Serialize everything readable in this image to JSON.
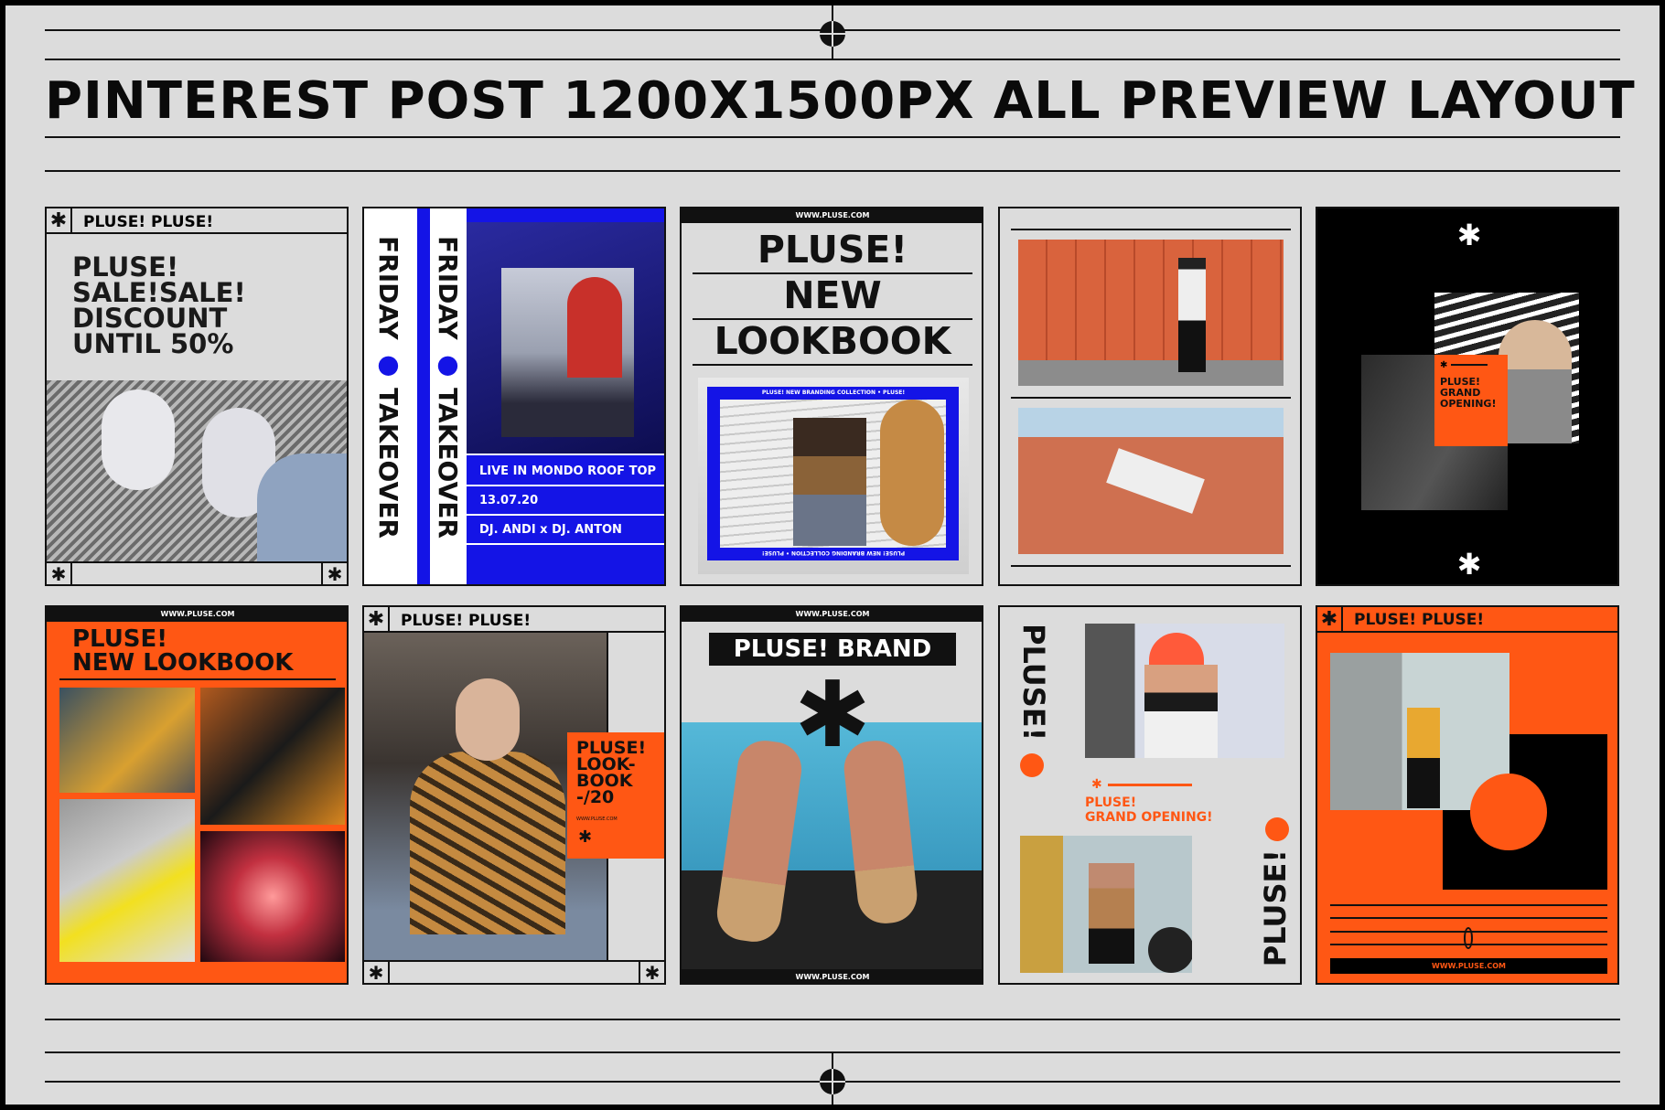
{
  "title": "PINTEREST POST 1200X1500PX ALL PREVIEW LAYOUT",
  "colors": {
    "background": "#dcdcdc",
    "orange": "#ff5714",
    "blue": "#1414e6",
    "black": "#000000"
  },
  "icons": {
    "asterisk": "asterisk-icon",
    "crosshair": "crosshair-icon"
  },
  "cards": {
    "c1": {
      "header": "PLUSE! PLUSE!",
      "lines": [
        "PLUSE!",
        "SALE!SALE!",
        "DISCOUNT",
        "UNTIL 50%"
      ]
    },
    "c2": {
      "vertical": [
        "FRIDAY",
        "TAKEOVER"
      ],
      "event": "LIVE IN MONDO ROOF TOP",
      "date": "13.07.20",
      "djs": "DJ. ANDI x DJ. ANTON"
    },
    "c3": {
      "url": "WWW.PLUSE.COM",
      "lines": [
        "PLUSE!",
        "NEW",
        "LOOKBOOK"
      ],
      "frame_text": "PLUSE! NEW BRANDING COLLECTION • PLUSE!"
    },
    "c5": {
      "text": [
        "PLUSE!",
        "GRAND",
        "OPENING!"
      ]
    },
    "c6": {
      "url": "WWW.PLUSE.COM",
      "lines": [
        "PLUSE!",
        "NEW LOOKBOOK"
      ]
    },
    "c7": {
      "header": "PLUSE! PLUSE!",
      "badge": [
        "PLUSE!",
        "LOOK-",
        "BOOK",
        "-/20"
      ],
      "url": "WWW.PLUSE.COM"
    },
    "c8": {
      "url": "WWW.PLUSE.COM",
      "brand": "PLUSE! BRAND",
      "url_bottom": "WWW.PLUSE.COM"
    },
    "c9": {
      "vertical": "PLUSE!",
      "lines": [
        "PLUSE!",
        "GRAND OPENING!"
      ]
    },
    "c10": {
      "header": "PLUSE! PLUSE!",
      "url": "WWW.PLUSE.COM"
    }
  }
}
